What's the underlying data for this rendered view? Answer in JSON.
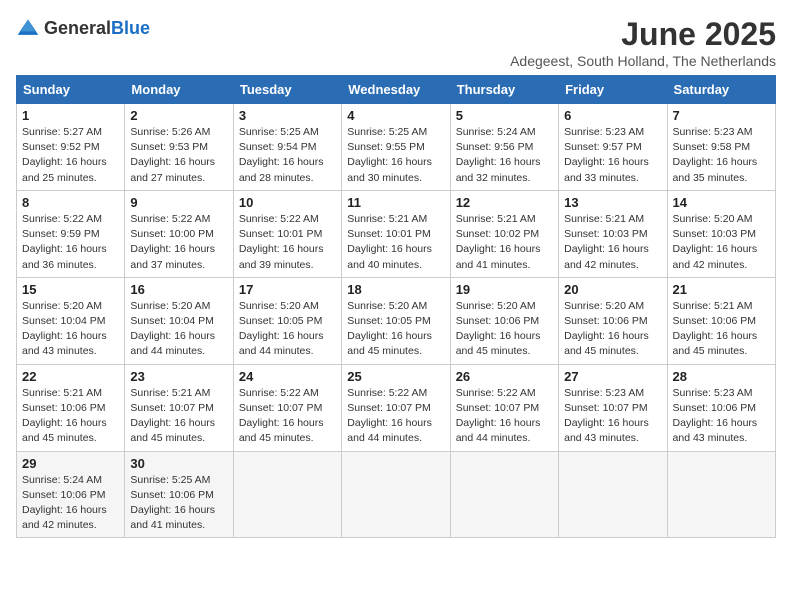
{
  "logo": {
    "general": "General",
    "blue": "Blue"
  },
  "header": {
    "month_title": "June 2025",
    "subtitle": "Adegeest, South Holland, The Netherlands"
  },
  "weekdays": [
    "Sunday",
    "Monday",
    "Tuesday",
    "Wednesday",
    "Thursday",
    "Friday",
    "Saturday"
  ],
  "weeks": [
    [
      {
        "day": "1",
        "sunrise": "5:27 AM",
        "sunset": "9:52 PM",
        "daylight": "16 hours and 25 minutes."
      },
      {
        "day": "2",
        "sunrise": "5:26 AM",
        "sunset": "9:53 PM",
        "daylight": "16 hours and 27 minutes."
      },
      {
        "day": "3",
        "sunrise": "5:25 AM",
        "sunset": "9:54 PM",
        "daylight": "16 hours and 28 minutes."
      },
      {
        "day": "4",
        "sunrise": "5:25 AM",
        "sunset": "9:55 PM",
        "daylight": "16 hours and 30 minutes."
      },
      {
        "day": "5",
        "sunrise": "5:24 AM",
        "sunset": "9:56 PM",
        "daylight": "16 hours and 32 minutes."
      },
      {
        "day": "6",
        "sunrise": "5:23 AM",
        "sunset": "9:57 PM",
        "daylight": "16 hours and 33 minutes."
      },
      {
        "day": "7",
        "sunrise": "5:23 AM",
        "sunset": "9:58 PM",
        "daylight": "16 hours and 35 minutes."
      }
    ],
    [
      {
        "day": "8",
        "sunrise": "5:22 AM",
        "sunset": "9:59 PM",
        "daylight": "16 hours and 36 minutes."
      },
      {
        "day": "9",
        "sunrise": "5:22 AM",
        "sunset": "10:00 PM",
        "daylight": "16 hours and 37 minutes."
      },
      {
        "day": "10",
        "sunrise": "5:22 AM",
        "sunset": "10:01 PM",
        "daylight": "16 hours and 39 minutes."
      },
      {
        "day": "11",
        "sunrise": "5:21 AM",
        "sunset": "10:01 PM",
        "daylight": "16 hours and 40 minutes."
      },
      {
        "day": "12",
        "sunrise": "5:21 AM",
        "sunset": "10:02 PM",
        "daylight": "16 hours and 41 minutes."
      },
      {
        "day": "13",
        "sunrise": "5:21 AM",
        "sunset": "10:03 PM",
        "daylight": "16 hours and 42 minutes."
      },
      {
        "day": "14",
        "sunrise": "5:20 AM",
        "sunset": "10:03 PM",
        "daylight": "16 hours and 42 minutes."
      }
    ],
    [
      {
        "day": "15",
        "sunrise": "5:20 AM",
        "sunset": "10:04 PM",
        "daylight": "16 hours and 43 minutes."
      },
      {
        "day": "16",
        "sunrise": "5:20 AM",
        "sunset": "10:04 PM",
        "daylight": "16 hours and 44 minutes."
      },
      {
        "day": "17",
        "sunrise": "5:20 AM",
        "sunset": "10:05 PM",
        "daylight": "16 hours and 44 minutes."
      },
      {
        "day": "18",
        "sunrise": "5:20 AM",
        "sunset": "10:05 PM",
        "daylight": "16 hours and 45 minutes."
      },
      {
        "day": "19",
        "sunrise": "5:20 AM",
        "sunset": "10:06 PM",
        "daylight": "16 hours and 45 minutes."
      },
      {
        "day": "20",
        "sunrise": "5:20 AM",
        "sunset": "10:06 PM",
        "daylight": "16 hours and 45 minutes."
      },
      {
        "day": "21",
        "sunrise": "5:21 AM",
        "sunset": "10:06 PM",
        "daylight": "16 hours and 45 minutes."
      }
    ],
    [
      {
        "day": "22",
        "sunrise": "5:21 AM",
        "sunset": "10:06 PM",
        "daylight": "16 hours and 45 minutes."
      },
      {
        "day": "23",
        "sunrise": "5:21 AM",
        "sunset": "10:07 PM",
        "daylight": "16 hours and 45 minutes."
      },
      {
        "day": "24",
        "sunrise": "5:22 AM",
        "sunset": "10:07 PM",
        "daylight": "16 hours and 45 minutes."
      },
      {
        "day": "25",
        "sunrise": "5:22 AM",
        "sunset": "10:07 PM",
        "daylight": "16 hours and 44 minutes."
      },
      {
        "day": "26",
        "sunrise": "5:22 AM",
        "sunset": "10:07 PM",
        "daylight": "16 hours and 44 minutes."
      },
      {
        "day": "27",
        "sunrise": "5:23 AM",
        "sunset": "10:07 PM",
        "daylight": "16 hours and 43 minutes."
      },
      {
        "day": "28",
        "sunrise": "5:23 AM",
        "sunset": "10:06 PM",
        "daylight": "16 hours and 43 minutes."
      }
    ],
    [
      {
        "day": "29",
        "sunrise": "5:24 AM",
        "sunset": "10:06 PM",
        "daylight": "16 hours and 42 minutes."
      },
      {
        "day": "30",
        "sunrise": "5:25 AM",
        "sunset": "10:06 PM",
        "daylight": "16 hours and 41 minutes."
      },
      null,
      null,
      null,
      null,
      null
    ]
  ]
}
